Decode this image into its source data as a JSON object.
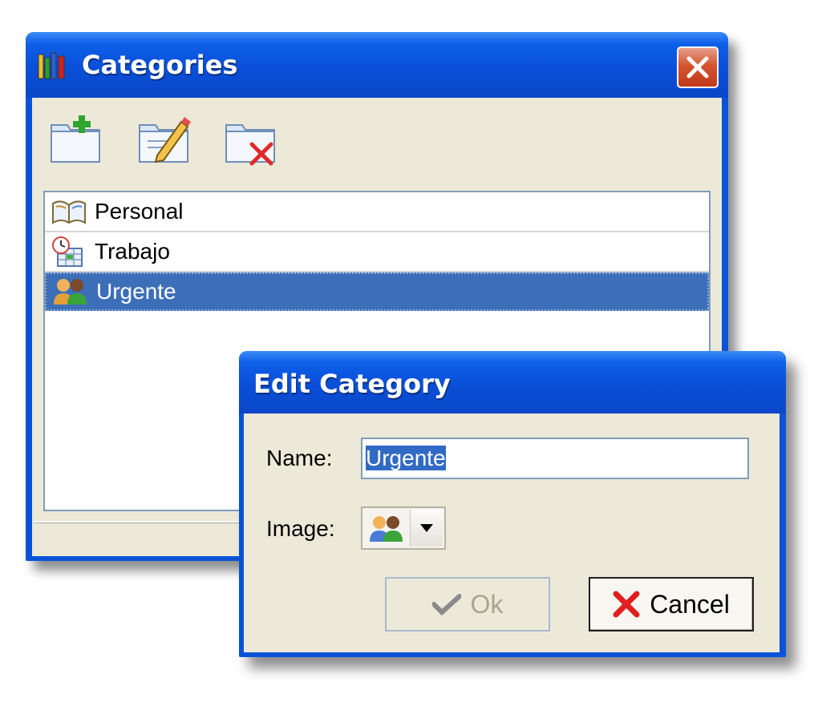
{
  "categories_window": {
    "title": "Categories",
    "toolbar": {
      "add_icon": "folder-add-icon",
      "edit_icon": "folder-edit-icon",
      "delete_icon": "folder-delete-icon"
    },
    "items": [
      {
        "label": "Personal",
        "icon": "book-icon",
        "selected": false
      },
      {
        "label": "Trabajo",
        "icon": "calendar-clock-icon",
        "selected": false
      },
      {
        "label": "Urgente",
        "icon": "people-icon",
        "selected": true
      }
    ]
  },
  "edit_dialog": {
    "title": "Edit Category",
    "name_label": "Name:",
    "name_value": "Urgente",
    "image_label": "Image:",
    "image_value_icon": "people-icon",
    "ok_label": "Ok",
    "cancel_label": "Cancel"
  },
  "colors": {
    "titlebar": "#0a53d8",
    "selection": "#3d6fb9",
    "dialog_body": "#ece9d8"
  }
}
